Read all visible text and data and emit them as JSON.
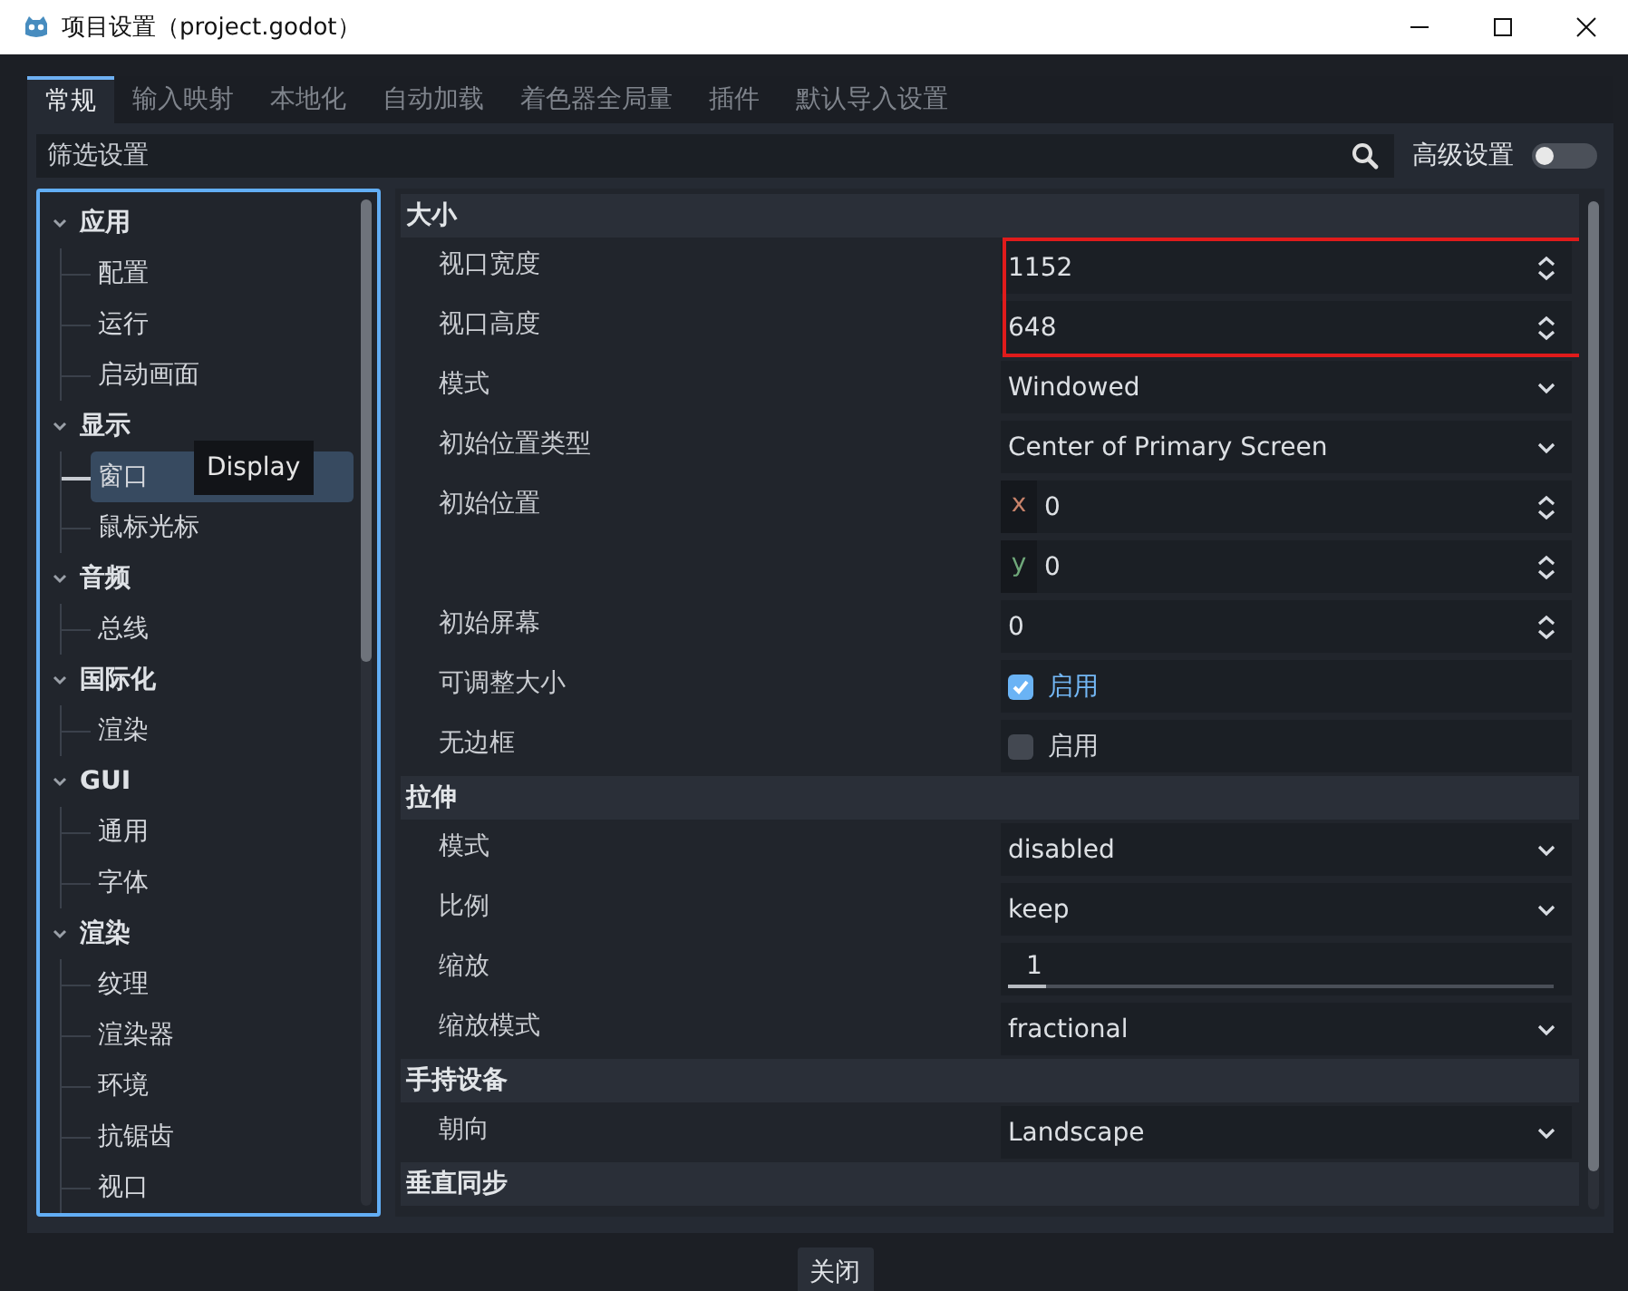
{
  "window": {
    "title": "项目设置（project.godot）"
  },
  "tabs": [
    {
      "label": "常规",
      "selected": true
    },
    {
      "label": "输入映射",
      "selected": false
    },
    {
      "label": "本地化",
      "selected": false
    },
    {
      "label": "自动加载",
      "selected": false
    },
    {
      "label": "着色器全局量",
      "selected": false
    },
    {
      "label": "插件",
      "selected": false
    },
    {
      "label": "默认导入设置",
      "selected": false
    }
  ],
  "filter": {
    "placeholder": "筛选设置",
    "advanced_label": "高级设置",
    "advanced_on": false
  },
  "tree": [
    {
      "label": "应用",
      "expanded": true,
      "children": [
        {
          "label": "配置",
          "selected": false
        },
        {
          "label": "运行",
          "selected": false
        },
        {
          "label": "启动画面",
          "selected": false
        }
      ]
    },
    {
      "label": "显示",
      "expanded": true,
      "children": [
        {
          "label": "窗口",
          "selected": true
        },
        {
          "label": "鼠标光标",
          "selected": false
        }
      ]
    },
    {
      "label": "音频",
      "expanded": true,
      "children": [
        {
          "label": "总线",
          "selected": false
        }
      ]
    },
    {
      "label": "国际化",
      "expanded": true,
      "children": [
        {
          "label": "渲染",
          "selected": false
        }
      ]
    },
    {
      "label": "GUI",
      "expanded": true,
      "children": [
        {
          "label": "通用",
          "selected": false
        },
        {
          "label": "字体",
          "selected": false
        }
      ]
    },
    {
      "label": "渲染",
      "expanded": true,
      "children": [
        {
          "label": "纹理",
          "selected": false
        },
        {
          "label": "渲染器",
          "selected": false
        },
        {
          "label": "环境",
          "selected": false
        },
        {
          "label": "抗锯齿",
          "selected": false
        },
        {
          "label": "视口",
          "selected": false
        }
      ]
    }
  ],
  "tooltip": {
    "text": "Display"
  },
  "sections": [
    {
      "title": "大小",
      "rows": [
        {
          "label": "视口宽度",
          "kind": "spin",
          "value": "1152",
          "highlighted": true
        },
        {
          "label": "视口高度",
          "kind": "spin",
          "value": "648",
          "highlighted": true
        },
        {
          "label": "模式",
          "kind": "select",
          "value": "Windowed",
          "highlighted": false
        },
        {
          "label": "初始位置类型",
          "kind": "select",
          "value": "Center of Primary Screen",
          "highlighted": false
        },
        {
          "label": "初始位置",
          "kind": "vector",
          "components": [
            {
              "axis": "x",
              "value": "0"
            },
            {
              "axis": "y",
              "value": "0"
            }
          ],
          "highlighted": false
        },
        {
          "label": "初始屏幕",
          "kind": "spin",
          "value": "0",
          "highlighted": false
        },
        {
          "label": "可调整大小",
          "kind": "check",
          "checked": true,
          "text": "启用",
          "highlighted": false
        },
        {
          "label": "无边框",
          "kind": "check",
          "checked": false,
          "text": "启用",
          "highlighted": false
        }
      ]
    },
    {
      "title": "拉伸",
      "rows": [
        {
          "label": "模式",
          "kind": "select",
          "value": "disabled",
          "highlighted": false
        },
        {
          "label": "比例",
          "kind": "select",
          "value": "keep",
          "highlighted": false
        },
        {
          "label": "缩放",
          "kind": "slider",
          "value": "1",
          "level": 0.07,
          "highlighted": false
        },
        {
          "label": "缩放模式",
          "kind": "select",
          "value": "fractional",
          "highlighted": false
        }
      ]
    },
    {
      "title": "手持设备",
      "rows": [
        {
          "label": "朝向",
          "kind": "select",
          "value": "Landscape",
          "highlighted": false
        }
      ]
    },
    {
      "title": "垂直同步"
    }
  ],
  "buttons": [
    {
      "label": "关闭"
    }
  ]
}
